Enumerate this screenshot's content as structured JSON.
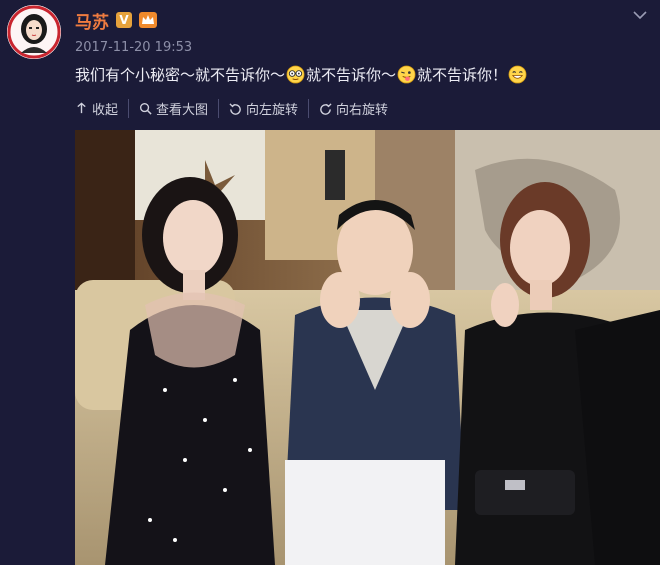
{
  "user": {
    "name": "马苏",
    "verified_badge": "V"
  },
  "post": {
    "timestamp": "2017-11-20 19:53",
    "text_segments": [
      "我们有个小秘密～就不告诉你～",
      "就不告诉你～",
      "就不告诉你！"
    ],
    "emojis": [
      "glasses-emoji",
      "tongue-emoji",
      "grin-emoji"
    ]
  },
  "toolbar": {
    "collapse": "收起",
    "view_large": "查看大图",
    "rotate_left": "向左旋转",
    "rotate_right": "向右旋转"
  },
  "colors": {
    "background": "#1b1b38",
    "username": "#f07c40",
    "timestamp": "#8d8fa8"
  }
}
